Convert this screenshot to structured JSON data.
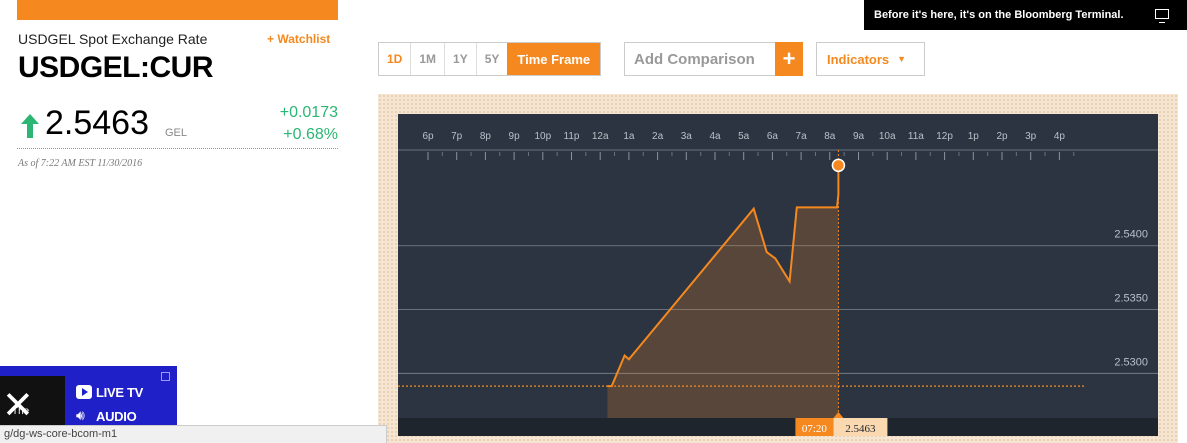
{
  "promo": {
    "text": "Before it's here, it's on the Bloomberg Terminal."
  },
  "quote": {
    "name": "USDGEL Spot Exchange Rate",
    "watchlist_label": "+ Watchlist",
    "ticker": "USDGEL:CUR",
    "price": "2.5463",
    "currency": "GEL",
    "change_abs": "+0.0173",
    "change_pct": "+0.68%",
    "as_of": "As of 7:22 AM EST 11/30/2016",
    "direction_icon": "up-arrow-icon",
    "up_color": "#2bb673"
  },
  "toolbar": {
    "timeframes": [
      "1D",
      "1M",
      "1Y",
      "5Y"
    ],
    "time_frame_label": "Time Frame",
    "compare_placeholder": "Add Comparison",
    "plus_label": "+",
    "indicators_label": "Indicators",
    "indicators_caret": "▼",
    "accent": "#f5891f"
  },
  "chart_data": {
    "type": "area",
    "x_ticks": [
      "6p",
      "7p",
      "8p",
      "9p",
      "10p",
      "11p",
      "12a",
      "1a",
      "2a",
      "3a",
      "4a",
      "5a",
      "6a",
      "7a",
      "8a",
      "9a",
      "10a",
      "11a",
      "12p",
      "1p",
      "2p",
      "3p",
      "4p"
    ],
    "y_ticks": [
      "2.5400",
      "2.5350",
      "2.5300"
    ],
    "y_tick_values": [
      2.54,
      2.535,
      2.53
    ],
    "ylim": [
      2.5265,
      2.5475
    ],
    "xlim": [
      17.5,
      40.5
    ],
    "series": [
      {
        "x": [
          24.25,
          24.4,
          24.85,
          25.0,
          29.35,
          29.8,
          30.1,
          30.6,
          30.85,
          32.25,
          32.3
        ],
        "y": [
          2.529,
          2.529,
          2.5314,
          2.5311,
          2.5429,
          2.5395,
          2.539,
          2.5372,
          2.543,
          2.543,
          2.544
        ]
      }
    ],
    "last_point": {
      "x": 32.3,
      "y": 2.5463
    },
    "previous_close": 2.529,
    "cursor_time": "07:20",
    "cursor_value": "2.5463",
    "line_color": "#f5891f",
    "background": "#2b3440"
  },
  "player": {
    "live_label": "LIVE TV",
    "audio_label": "AUDIO",
    "thumb_text": "The"
  },
  "status_url": "g/dg-ws-core-bcom-m1"
}
